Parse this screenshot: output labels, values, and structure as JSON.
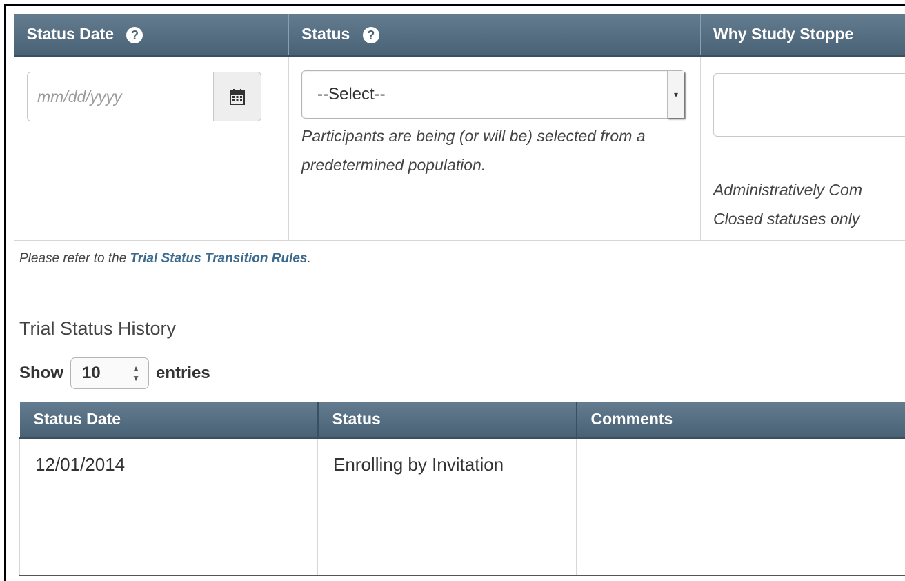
{
  "form": {
    "headers": {
      "status_date": "Status Date",
      "status": "Status",
      "why_stopped": "Why Study Stoppe"
    },
    "help_icon": "?",
    "date_input": {
      "placeholder": "mm/dd/yyyy"
    },
    "calendar_icon": "calendar-icon",
    "status_select": {
      "value": "--Select--"
    },
    "status_help": "Participants are being (or will be) selected from a predetermined population.",
    "why_help_line1": "Administratively Com",
    "why_help_line2": "Closed statuses only"
  },
  "refer": {
    "prefix": "Please refer to the ",
    "link": "Trial Status Transition Rules",
    "suffix": "."
  },
  "history": {
    "title": "Trial Status History",
    "show_label": "Show",
    "entries_value": "10",
    "entries_label": "entries",
    "columns": [
      "Status Date",
      "Status",
      "Comments"
    ],
    "rows": [
      {
        "date": "12/01/2014",
        "status": "Enrolling by Invitation",
        "comments": ""
      }
    ]
  }
}
